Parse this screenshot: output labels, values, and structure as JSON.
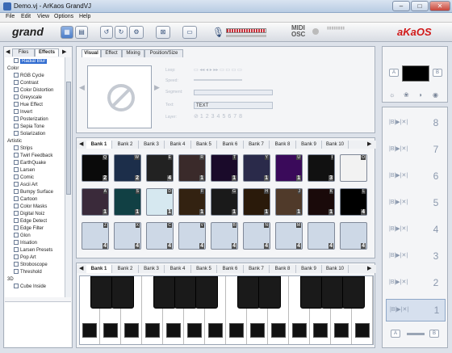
{
  "window": {
    "title": "Demo.vj - ArKaos GrandVJ"
  },
  "menu": [
    "File",
    "Edit",
    "View",
    "Options",
    "Help"
  ],
  "toolbar": {
    "logo": "grand",
    "brand": "aKaOS",
    "midi": "MIDI",
    "osc": "OSC"
  },
  "effects_panel": {
    "tabs": [
      "Files",
      "Effects"
    ],
    "items": [
      {
        "label": "Radial Blur",
        "type": "fx",
        "selected": true
      },
      {
        "label": "Color",
        "type": "cat"
      },
      {
        "label": "RGB Cycle",
        "type": "fx"
      },
      {
        "label": "Contrast",
        "type": "fx"
      },
      {
        "label": "Color Distortion",
        "type": "fx"
      },
      {
        "label": "Greyscale",
        "type": "fx"
      },
      {
        "label": "Hue Effect",
        "type": "fx"
      },
      {
        "label": "Invert",
        "type": "fx"
      },
      {
        "label": "Posterization",
        "type": "fx"
      },
      {
        "label": "Sepia Tone",
        "type": "fx"
      },
      {
        "label": "Solarization",
        "type": "fx"
      },
      {
        "label": "Artistic",
        "type": "cat"
      },
      {
        "label": "Strips",
        "type": "fx"
      },
      {
        "label": "Twirl Feedback",
        "type": "fx"
      },
      {
        "label": "EarthQuake",
        "type": "fx"
      },
      {
        "label": "Larsen",
        "type": "fx"
      },
      {
        "label": "Comic",
        "type": "fx"
      },
      {
        "label": "Ascii Art",
        "type": "fx"
      },
      {
        "label": "Bumpy Surface",
        "type": "fx"
      },
      {
        "label": "Cartoon",
        "type": "fx"
      },
      {
        "label": "Color Masks",
        "type": "fx"
      },
      {
        "label": "Digital Noiz",
        "type": "fx"
      },
      {
        "label": "Edge Detect",
        "type": "fx"
      },
      {
        "label": "Edge Filter",
        "type": "fx"
      },
      {
        "label": "Glon",
        "type": "fx"
      },
      {
        "label": "Irisation",
        "type": "fx"
      },
      {
        "label": "Larsen Presets",
        "type": "fx"
      },
      {
        "label": "Pop Art",
        "type": "fx"
      },
      {
        "label": "Stroboscope",
        "type": "fx"
      },
      {
        "label": "Threshold",
        "type": "fx"
      },
      {
        "label": "3D",
        "type": "cat"
      },
      {
        "label": "Cube Inside",
        "type": "fx"
      }
    ]
  },
  "visual_panel": {
    "tabs": [
      "Visual",
      "Effect",
      "Mixing",
      "Position/Size"
    ],
    "fields": [
      "Loop:",
      "Speed:",
      "Segment:",
      "Text:",
      "Layer:"
    ],
    "text_value": "TEXT",
    "layer_numbers": [
      "1",
      "2",
      "3",
      "4",
      "5",
      "6",
      "7",
      "8"
    ]
  },
  "bank_tabs": [
    "Bank 1",
    "Bank 2",
    "Bank 3",
    "Bank 4",
    "Bank 5",
    "Bank 6",
    "Bank 7",
    "Bank 8",
    "Bank 9",
    "Bank 10"
  ],
  "grid_keys": [
    [
      "Q",
      "W",
      "E",
      "R",
      "T",
      "Y",
      "U",
      "I",
      "O"
    ],
    [
      "A",
      "S",
      "D",
      "F",
      "G",
      "H",
      "J",
      "K",
      "L"
    ],
    [
      "Z",
      "X",
      "C",
      "V",
      "B",
      "N",
      "M",
      "",
      ""
    ]
  ],
  "grid_nums": [
    [
      "2",
      "2",
      "4",
      "1",
      "1",
      "1",
      "1",
      "3",
      ""
    ],
    [
      "1",
      "1",
      "1",
      "1",
      "1",
      "1",
      "1",
      "1",
      "4"
    ],
    [
      "4",
      "4",
      "4",
      "4",
      "4",
      "4",
      "4",
      "4",
      "4"
    ]
  ],
  "keyboard_tabs": [
    "Bank 1",
    "Bank 2",
    "Bank 3",
    "Bank 4",
    "Bank 5",
    "Bank 6",
    "Bank 7",
    "Bank 8",
    "Bank 9",
    "Bank 10"
  ],
  "master": {
    "a": "A",
    "b": "B"
  },
  "layers": [
    "8",
    "7",
    "6",
    "5",
    "4",
    "3",
    "2",
    "1"
  ],
  "crossfader": {
    "a": "A",
    "b": "B"
  },
  "colors": {
    "accent": "#2f6bd0",
    "brand": "#d11919"
  }
}
